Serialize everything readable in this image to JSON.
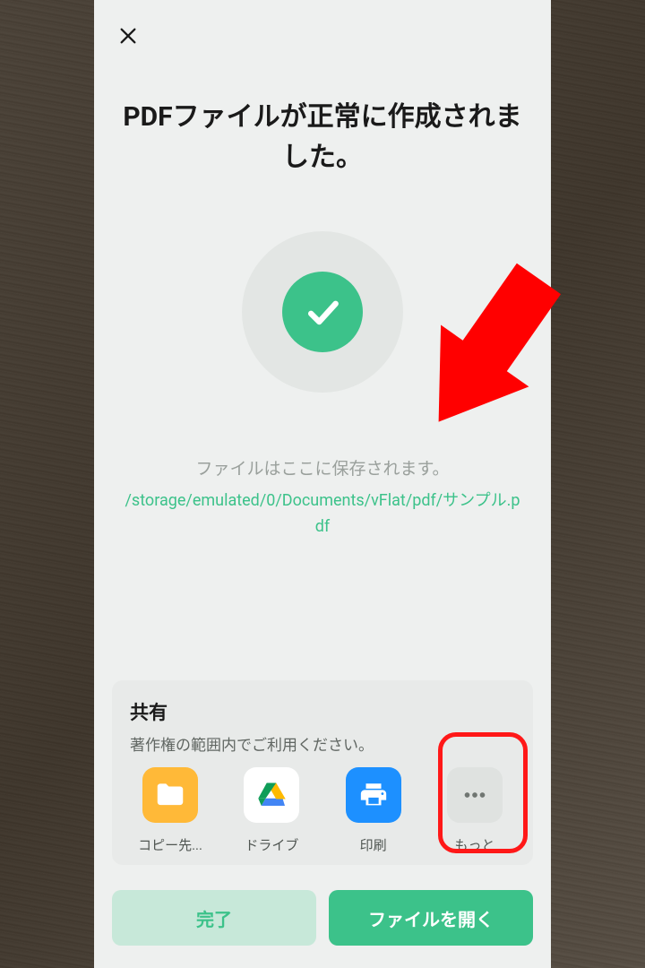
{
  "modal": {
    "title": "PDFファイルが正常に作成されました。",
    "saved_label": "ファイルはここに保存されます。",
    "file_path": "/storage/emulated/0/Documents/vFlat/pdf/サンプル.pdf"
  },
  "share": {
    "title": "共有",
    "subtitle": "著作権の範囲内でご利用ください。",
    "items": [
      {
        "label": "コピー先...",
        "icon": "folder"
      },
      {
        "label": "ドライブ",
        "icon": "drive"
      },
      {
        "label": "印刷",
        "icon": "print"
      },
      {
        "label": "もっと",
        "icon": "more"
      }
    ]
  },
  "buttons": {
    "done": "完了",
    "open": "ファイルを開く"
  },
  "colors": {
    "accent": "#3cc28a",
    "highlight": "#ff1818"
  }
}
